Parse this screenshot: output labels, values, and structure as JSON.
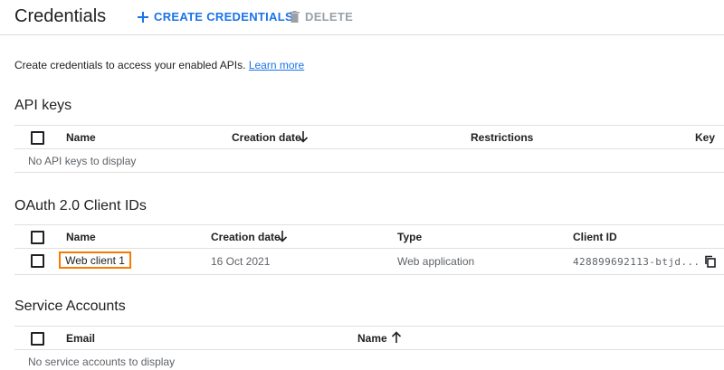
{
  "header": {
    "title": "Credentials",
    "create_label": "CREATE CREDENTIALS",
    "delete_label": "DELETE"
  },
  "intro": {
    "text": "Create credentials to access your enabled APIs.",
    "link": "Learn more"
  },
  "api_keys": {
    "title": "API keys",
    "columns": [
      "Name",
      "Creation date",
      "Restrictions",
      "Key"
    ],
    "empty": "No API keys to display"
  },
  "oauth": {
    "title": "OAuth 2.0 Client IDs",
    "columns": [
      "Name",
      "Creation date",
      "Type",
      "Client ID"
    ],
    "rows": [
      {
        "name": "Web client 1",
        "date": "16 Oct 2021",
        "type": "Web application",
        "client_id": "428899692113-btjd..."
      }
    ]
  },
  "service_accounts": {
    "title": "Service Accounts",
    "columns": [
      "Email",
      "Name"
    ],
    "empty": "No service accounts to display"
  },
  "colors": {
    "accent": "#1a73e8",
    "highlight_border": "#f57c00",
    "divider": "#e0e0e0"
  },
  "icons": {
    "create": "plus-icon",
    "delete": "trash-icon",
    "sort_desc": "arrow-down-icon",
    "sort_asc": "arrow-up-icon",
    "copy": "copy-icon"
  }
}
